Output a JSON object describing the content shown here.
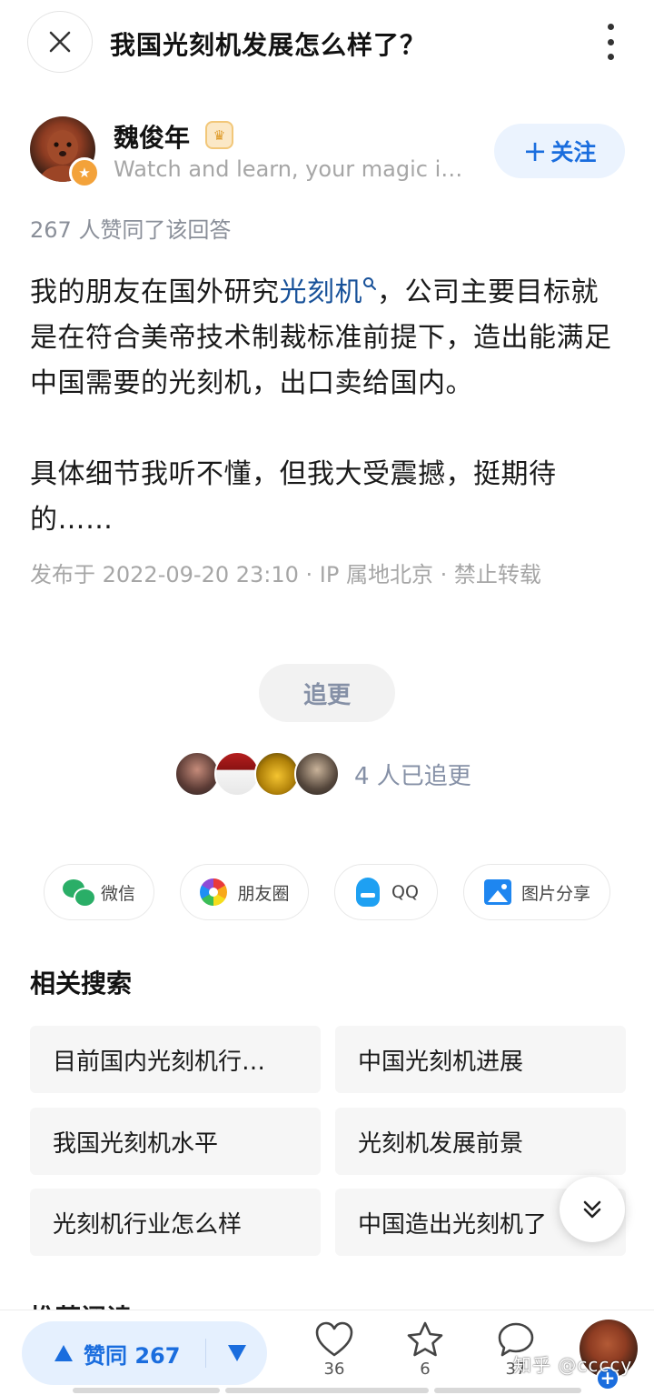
{
  "header": {
    "question_title": "我国光刻机发展怎么样了？"
  },
  "author": {
    "name": "魏俊年",
    "bio": "Watch and learn, your magic i…",
    "follow_label": "关注"
  },
  "answer": {
    "vote_summary": "267 人赞同了该回答",
    "paragraph1_before": "我的朋友在国外研究",
    "keyword": "光刻机",
    "paragraph1_after": "，公司主要目标就是在符合美帝技术制裁标准前提下，造出能满足中国需要的光刻机，出口卖给国内。",
    "paragraph2": "具体细节我听不懂，但我大受震撼，挺期待的……",
    "meta": "发布于 2022-09-20 23:10 · IP 属地北京 · 禁止转载"
  },
  "follow_up": {
    "button_label": "追更",
    "count_text": "4 人已追更"
  },
  "share": [
    {
      "label": "微信",
      "icon": "wechat-icon"
    },
    {
      "label": "朋友圈",
      "icon": "moments-icon"
    },
    {
      "label": "QQ",
      "icon": "qq-icon"
    },
    {
      "label": "图片分享",
      "icon": "image-share-icon"
    }
  ],
  "related": {
    "title": "相关搜索",
    "items": [
      "目前国内光刻机行…",
      "中国光刻机进展",
      "我国光刻机水平",
      "光刻机发展前景",
      "光刻机行业怎么样",
      "中国造出光刻机了"
    ]
  },
  "next_section": {
    "title": "推荐阅读"
  },
  "bottom_bar": {
    "vote_label": "赞同 267",
    "like_count": "36",
    "favorite_count": "6",
    "comment_count": "37",
    "watermark": "知乎 @ccccy"
  },
  "colors": {
    "accent": "#1a6dde",
    "accent_bg": "#e5f0fe",
    "link": "#175199",
    "muted": "#8590a6"
  }
}
